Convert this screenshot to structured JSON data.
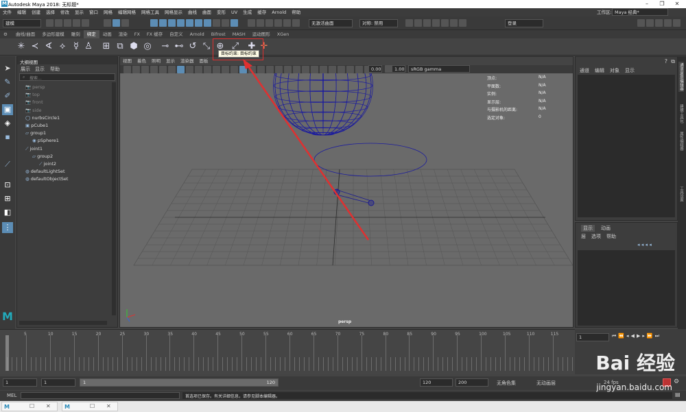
{
  "window": {
    "title": "Autodesk Maya 2018: 无标题*",
    "logo": "M"
  },
  "menubar": {
    "items": [
      "文件",
      "编辑",
      "创建",
      "选择",
      "修改",
      "显示",
      "窗口",
      "网格",
      "编辑网格",
      "网格工具",
      "网格显示",
      "曲线",
      "曲面",
      "变形",
      "UV",
      "生成",
      "缓存",
      "Arnold",
      "帮助"
    ]
  },
  "statusline": {
    "mode": "建模",
    "live_surface": "无激活曲面",
    "symmetry_label": "对称: 禁用",
    "signin": "登录",
    "workspace_label": "工作区:",
    "workspace_value": "Maya 经典*"
  },
  "shelf_tabs": {
    "items": [
      "曲线/曲面",
      "多边形建模",
      "雕刻",
      "绑定",
      "动画",
      "渲染",
      "FX",
      "FX 缓存",
      "自定义",
      "Arnold",
      "Bifrost",
      "MASH",
      "运动图形",
      "XGen"
    ],
    "active": "绑定"
  },
  "tooltip": "目标约束: 目标约束",
  "outliner": {
    "title": "大纲视图",
    "menu": [
      "展示",
      "显示",
      "帮助"
    ],
    "search_placeholder": "搜索...",
    "items": [
      {
        "label": "persp",
        "dim": true
      },
      {
        "label": "top",
        "dim": true
      },
      {
        "label": "front",
        "dim": true
      },
      {
        "label": "side",
        "dim": true
      },
      {
        "label": "nurbsCircle1",
        "dim": false
      },
      {
        "label": "pCube1",
        "dim": false
      },
      {
        "label": "group1",
        "dim": false
      },
      {
        "label": "pSphere1",
        "dim": false
      },
      {
        "label": "joint1",
        "dim": false
      },
      {
        "label": "group2",
        "dim": false
      },
      {
        "label": "joint2",
        "dim": false
      },
      {
        "label": "defaultLightSet",
        "dim": false
      },
      {
        "label": "defaultObjectSet",
        "dim": false
      }
    ]
  },
  "viewport": {
    "menu": [
      "视图",
      "着色",
      "照明",
      "显示",
      "渲染器",
      "面板"
    ],
    "exposure": "0.00",
    "gamma": "1.00",
    "colorspace": "sRGB gamma",
    "camera_label": "persp",
    "hud": [
      {
        "label": "顶点:",
        "value": "N/A"
      },
      {
        "label": "平面数:",
        "value": "N/A"
      },
      {
        "label": "实例:",
        "value": "N/A"
      },
      {
        "label": "显示层:",
        "value": "N/A"
      },
      {
        "label": "与摄影机的距离:",
        "value": "N/A"
      },
      {
        "label": "选定对象:",
        "value": "0"
      }
    ]
  },
  "channelbox": {
    "menu": [
      "通道",
      "编辑",
      "对象",
      "显示"
    ]
  },
  "layerpanel": {
    "tabs": [
      "显示",
      "动画"
    ],
    "menu": [
      "层",
      "选项",
      "帮助"
    ]
  },
  "timeline": {
    "ticks": [
      "5",
      "10",
      "15",
      "20",
      "25",
      "30",
      "35",
      "40",
      "45",
      "50",
      "55",
      "60",
      "65",
      "70",
      "75",
      "80",
      "85",
      "90",
      "95",
      "100",
      "105",
      "110",
      "115",
      "120"
    ],
    "current_frame": "1"
  },
  "range": {
    "start": "1",
    "start2": "1",
    "range_start": "1",
    "range_end": "120",
    "end": "120",
    "end2": "200",
    "char_set": "无角色集",
    "anim_layer": "无动画层",
    "fps": "24 fps"
  },
  "commandline": {
    "label": "MEL",
    "message": "首选项已保存。有关详细信息，请参见脚本编辑器。"
  },
  "watermark": {
    "brand": "Bai 经验",
    "url": "jingyan.baidu.com"
  },
  "vertical_tabs": [
    "通道盒/层编辑器",
    "建模工具包",
    "属性编辑器",
    "工具设置"
  ],
  "accent": "#5c8db5",
  "annotation_color": "#e03030"
}
